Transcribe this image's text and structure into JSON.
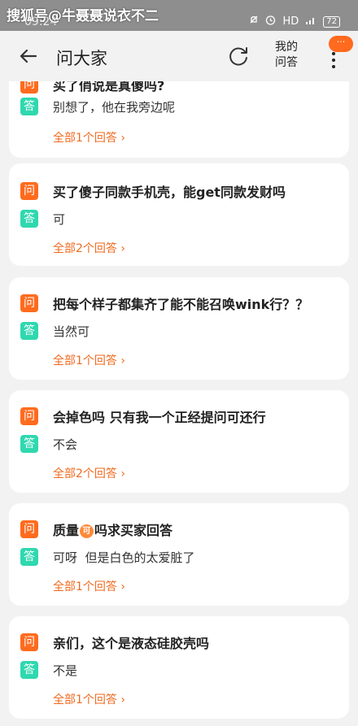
{
  "status_bar": {
    "watermark": "搜狐号@牛聂聂说衣不二",
    "time": "09:24",
    "network": "HD",
    "battery": "72"
  },
  "header": {
    "back_icon": "arrow-left-icon",
    "title": "问大家",
    "refresh_icon": "refresh-icon",
    "my_answers_line1": "我的",
    "my_answers_line2": "问答",
    "more_icon": "more-vertical-icon",
    "notif_badge": "···"
  },
  "badges": {
    "question": "问",
    "answer": "答"
  },
  "first_card": {
    "question_partial": "买了俏说是真傻吗?",
    "answer": "别想了，他在我旁边呢",
    "link": "全部1个回答 ›"
  },
  "cards": [
    {
      "question": "买了傻子同款手机壳，能get同款发财吗",
      "answer": "可",
      "link": "全部2个回答 ›"
    },
    {
      "question": "把每个样子都集齐了能不能召唤wink行？？",
      "answer": "当然可",
      "link": "全部1个回答 ›"
    },
    {
      "question": "会掉色吗 只有我一个正经提问可还行",
      "answer": "不会",
      "link": "全部2个回答 ›"
    },
    {
      "question_pre": "质量",
      "question_tag": "可",
      "question_post": "吗求买家回答",
      "answer": "可呀  但是白色的太爱脏了",
      "link": "全部1个回答 ›"
    },
    {
      "question": "亲们，这个是液态硅胶壳吗",
      "answer": "不是",
      "link": "全部1个回答 ›"
    }
  ],
  "colors": {
    "accent": "#ef6a1f",
    "question_badge": "#ff6b1e",
    "answer_badge": "#2fd8ae"
  }
}
